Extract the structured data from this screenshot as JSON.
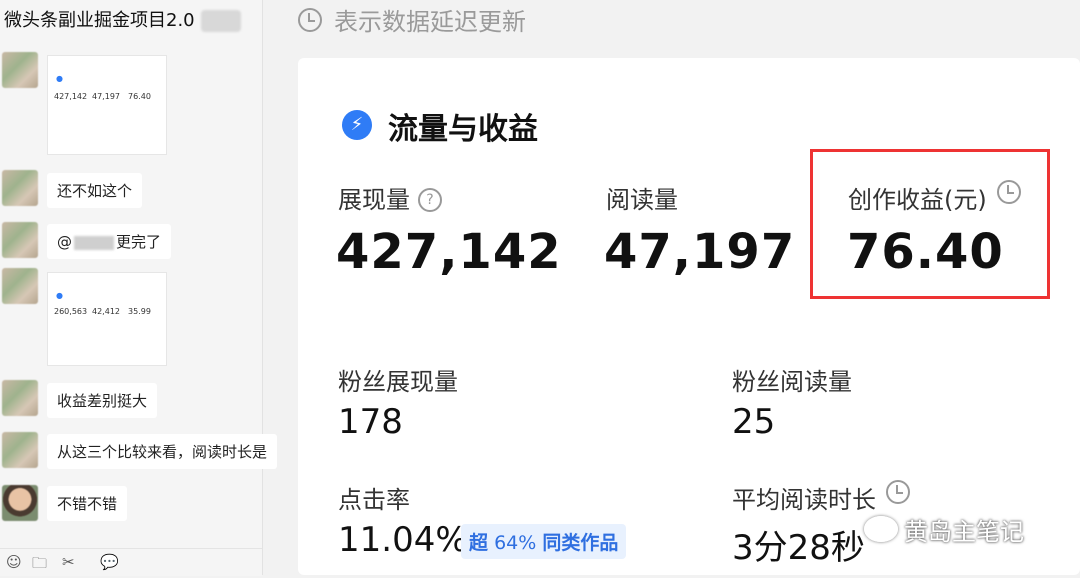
{
  "chat": {
    "title": "微头条副业掘金项目2.0",
    "messages": [
      {
        "type": "image",
        "rows": [
          "427,142",
          "47,197",
          "76.40"
        ]
      },
      {
        "type": "text",
        "text": "还不如这个"
      },
      {
        "type": "mention",
        "prefix": "@",
        "suffix": "更完了"
      },
      {
        "type": "image",
        "rows": [
          "260,563",
          "42,412",
          "35.99"
        ]
      },
      {
        "type": "text",
        "text": "收益差别挺大"
      },
      {
        "type": "text",
        "text": "从这三个比较来看，阅读时长是"
      },
      {
        "type": "text",
        "text": "不错不错"
      }
    ],
    "toolbar": {
      "emoji": "☺",
      "folder": "🗀",
      "scissors": "✂",
      "chat": "💬"
    }
  },
  "note": "表示数据延迟更新",
  "section": {
    "title": "流量与收益",
    "icon": "lightning-icon"
  },
  "metrics": {
    "impressions": {
      "label": "展现量",
      "value": "427,142"
    },
    "reads": {
      "label": "阅读量",
      "value": "47,197"
    },
    "earnings": {
      "label": "创作收益(元)",
      "value": "76.40"
    },
    "fan_impressions": {
      "label": "粉丝展现量",
      "value": "178"
    },
    "fan_reads": {
      "label": "粉丝阅读量",
      "value": "25"
    },
    "ctr": {
      "label": "点击率",
      "value": "11.04%",
      "badge_prefix": "超",
      "badge_pct": "64%",
      "badge_suffix": "同类作品"
    },
    "avg_time": {
      "label": "平均阅读时长",
      "value": "3分28秒"
    }
  },
  "watermark": "黄岛主笔记",
  "colors": {
    "accent": "#2f7cf6",
    "highlight": "#e33333"
  }
}
